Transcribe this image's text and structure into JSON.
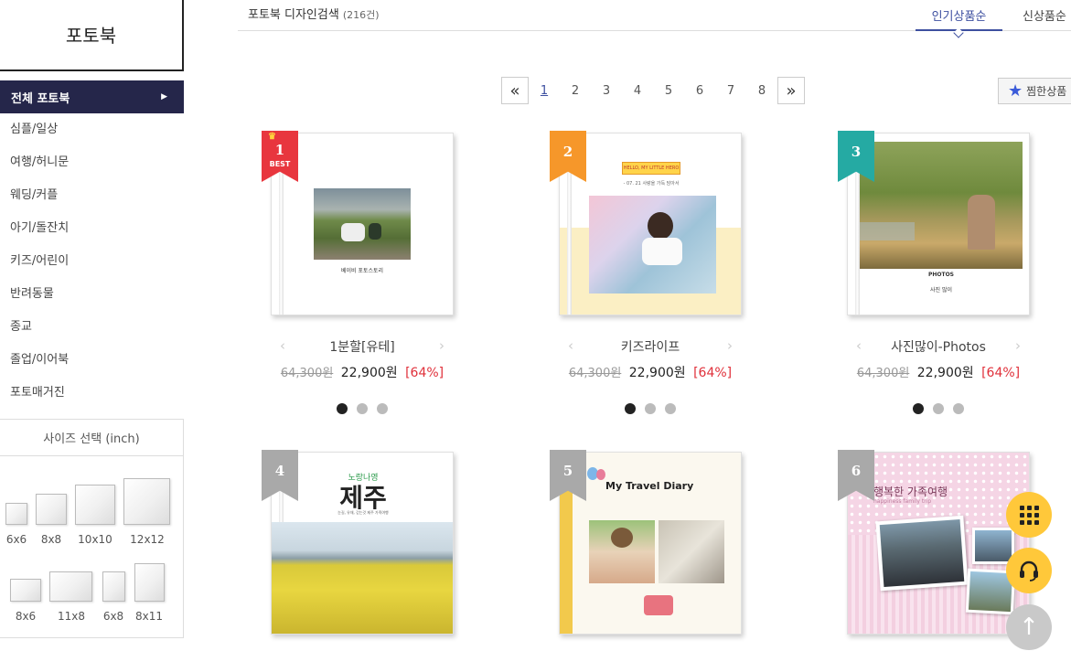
{
  "sidebar": {
    "title": "포토북",
    "active_category": "전체 포토북",
    "categories": [
      "심플/일상",
      "여행/허니문",
      "웨딩/커플",
      "아기/돌잔치",
      "키즈/어린이",
      "반려동물",
      "종교",
      "졸업/이어북",
      "포토매거진"
    ],
    "size_header": "사이즈 선택 (inch)",
    "sizes_row1": [
      "6x6",
      "8x8",
      "10x10",
      "12x12"
    ],
    "sizes_row2": [
      "8x6",
      "11x8",
      "6x8",
      "8x11"
    ]
  },
  "topbar": {
    "title": "포토북 디자인검색",
    "count": "(216건)",
    "sort_popular": "인기상품순",
    "sort_new": "신상품순"
  },
  "pager": {
    "prev": "«",
    "next": "»",
    "pages": [
      "1",
      "2",
      "3",
      "4",
      "5",
      "6",
      "7",
      "8"
    ],
    "current": "1"
  },
  "favorite_button": "찜한상품",
  "products": [
    {
      "rank": "1",
      "best": "BEST",
      "name": "1분할[유테]",
      "old_price": "64,300원",
      "price": "22,900원",
      "discount": "[64%]",
      "ribbon_color": "#e8363e",
      "cover_text": "베이비 포토스토리"
    },
    {
      "rank": "2",
      "name": "키즈라이프",
      "old_price": "64,300원",
      "price": "22,900원",
      "discount": "[64%]",
      "ribbon_color": "#f6972a",
      "cover_text": "HELLO, MY LITTLE HERO",
      "cover_sub": "- 07. 21 사랑을 가득 담아서"
    },
    {
      "rank": "3",
      "name": "사진많이-Photos",
      "old_price": "64,300원",
      "price": "22,900원",
      "discount": "[64%]",
      "ribbon_color": "#25aaa3",
      "cover_text": "PHOTOS",
      "cover_sub": "사진 많이"
    },
    {
      "rank": "4",
      "ribbon_color": "#a9a9a9",
      "cover_text": "제주",
      "cover_top": "노랑나영",
      "cover_sub": "눈길, 유채, 걷는것 제주 가족여행"
    },
    {
      "rank": "5",
      "ribbon_color": "#a9a9a9",
      "cover_text": "My Travel Diary"
    },
    {
      "rank": "6",
      "ribbon_color": "#a9a9a9",
      "cover_text": "행복한 가족여행",
      "cover_sub": "happiness family trip"
    }
  ],
  "icons": {
    "menu": "grid-menu-icon",
    "help": "headset-icon",
    "top": "arrow-up-icon"
  },
  "colors": {
    "accent": "#3d4fa0",
    "sidebar_active": "#25264a",
    "discount": "#e0303a",
    "fab": "#ffc83a"
  }
}
